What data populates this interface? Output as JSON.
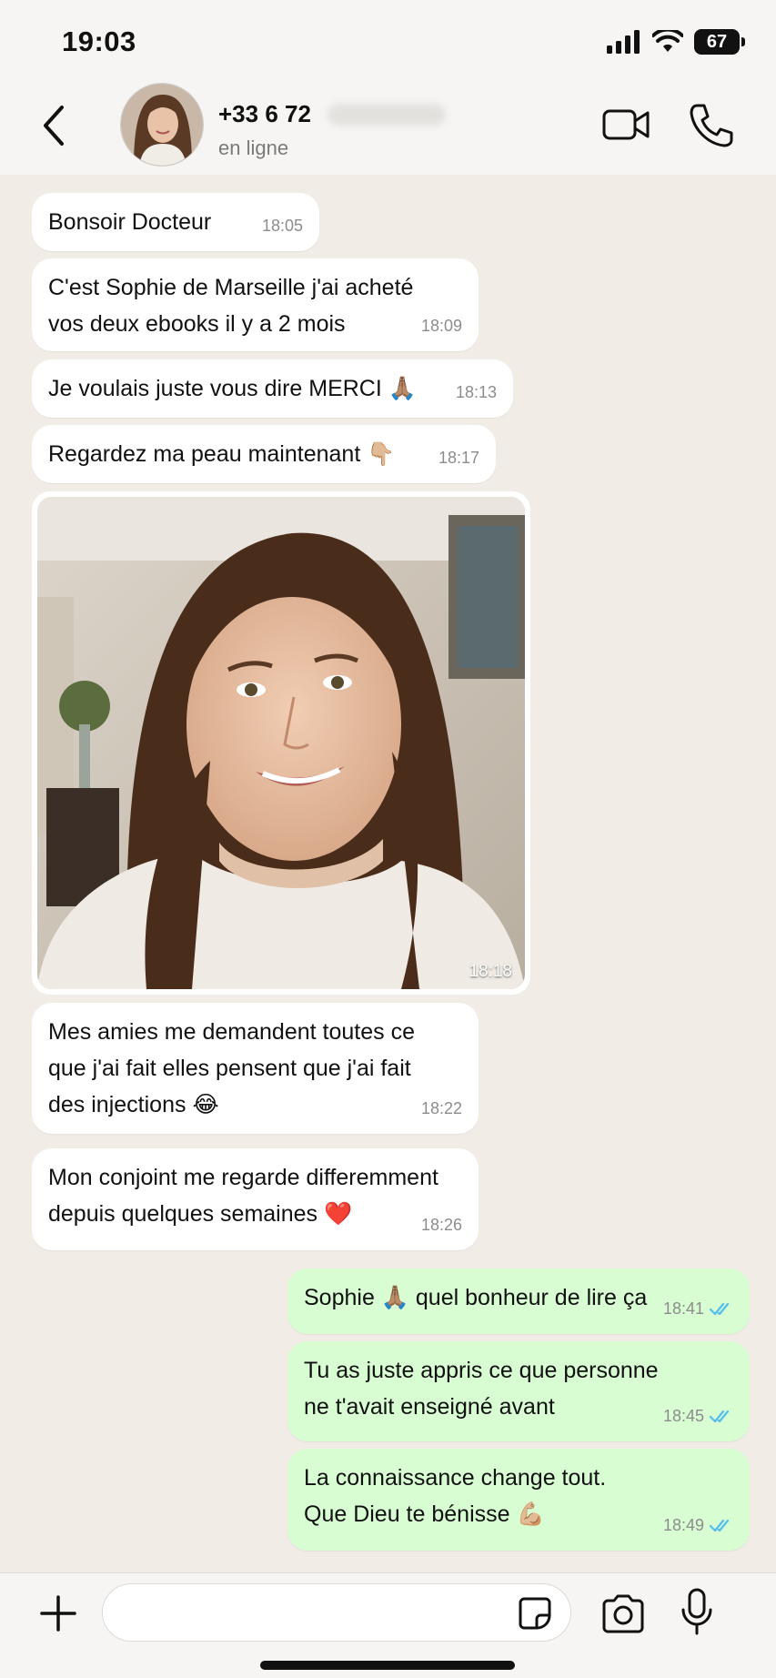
{
  "status_bar": {
    "time": "19:03",
    "battery": "67"
  },
  "header": {
    "back_icon": "chevron-left-icon",
    "contact_name": "+33 6 72",
    "contact_status": "en ligne",
    "video_icon": "video-camera-icon",
    "call_icon": "phone-icon"
  },
  "messages": [
    {
      "text": "Bonsoir Docteur",
      "time": "18:05"
    },
    {
      "line1": "C'est Sophie de Marseille j'ai acheté",
      "line2": "vos deux ebooks il y a 2 mois",
      "time": "18:09"
    },
    {
      "text": "Je voulais juste vous dire MERCI",
      "emoji": "🙏🏽",
      "time": "18:13"
    },
    {
      "text": "Regardez ma peau maintenant",
      "emoji": "👇🏼",
      "time": "18:17"
    },
    {
      "photo_time": "18:18"
    },
    {
      "line1": "Mes amies me demandent toutes ce",
      "line2": "que j'ai fait elles pensent que j'ai fait",
      "line3": "des injections",
      "emoji": "😂",
      "time": "18:22"
    },
    {
      "line1": "Mon conjoint me regarde differemment",
      "line2": "depuis quelques semaines",
      "emoji": "❤️",
      "time": "18:26"
    }
  ],
  "outgoing": [
    {
      "text_a": "Sophie",
      "emoji": "🙏🏽",
      "text_b": "quel bonheur de lire ça",
      "time": "18:41"
    },
    {
      "line1": "Tu as juste appris ce que personne",
      "line2": "ne t'avait enseigné avant",
      "time": "18:45"
    },
    {
      "line1": "La connaissance change tout.",
      "line2": "Que Dieu te bénisse",
      "emoji": "💪🏼",
      "time": "18:49"
    }
  ],
  "colors": {
    "incoming": "#ffffff",
    "outgoing": "#d9fdd3",
    "read_ticks": "#53bdeb",
    "background": "#f1ede6"
  },
  "bottom_bar": {
    "plus_icon": "plus-icon",
    "sticker_icon": "sticker-icon",
    "camera_icon": "camera-icon",
    "mic_icon": "microphone-icon"
  }
}
